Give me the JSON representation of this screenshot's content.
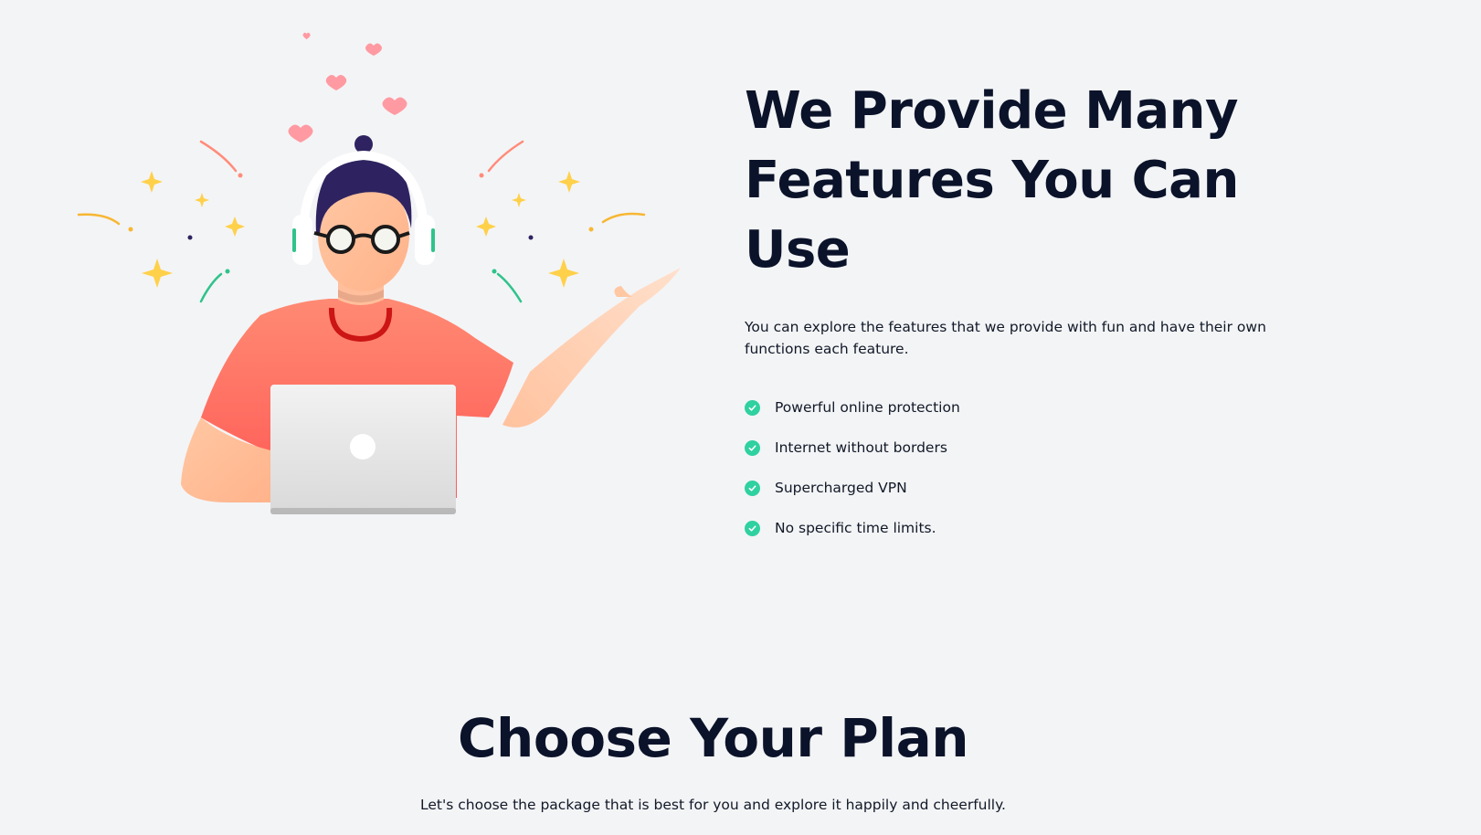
{
  "features": {
    "title_line1": "We Provide Many",
    "title_line2": "Features You Can Use",
    "description": "You can explore the features that we provide with fun and have their own functions each feature.",
    "items": [
      {
        "label": "Powerful online protection"
      },
      {
        "label": "Internet without borders"
      },
      {
        "label": "Supercharged VPN"
      },
      {
        "label": "No specific time limits."
      }
    ],
    "check_icon": "check-circle-icon",
    "check_color": "#2fd1a0"
  },
  "illustration": {
    "name": "person-with-laptop-illustration",
    "shirt_color": "#ff7a6b",
    "hair_color": "#2e2360"
  },
  "plan": {
    "title": "Choose Your Plan",
    "subtitle": "Let's choose the package that is best for you and explore it happily and cheerfully."
  },
  "colors": {
    "background": "#f3f4f6",
    "heading": "#0b132a",
    "accent_green": "#2fd1a0"
  }
}
